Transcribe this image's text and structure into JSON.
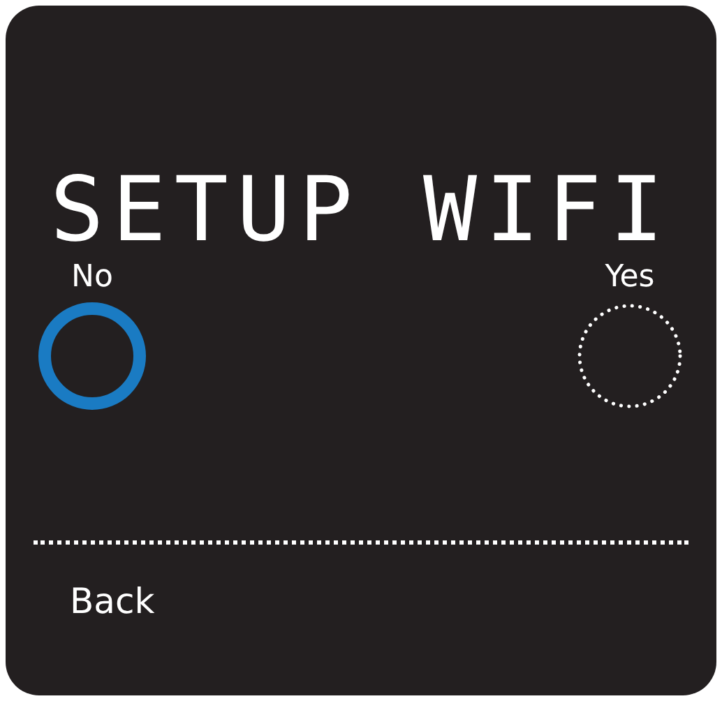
{
  "title": "SETUP WIFI",
  "options": [
    {
      "label": "No",
      "selected": true
    },
    {
      "label": "Yes",
      "selected": false
    }
  ],
  "back": {
    "label": "Back"
  }
}
